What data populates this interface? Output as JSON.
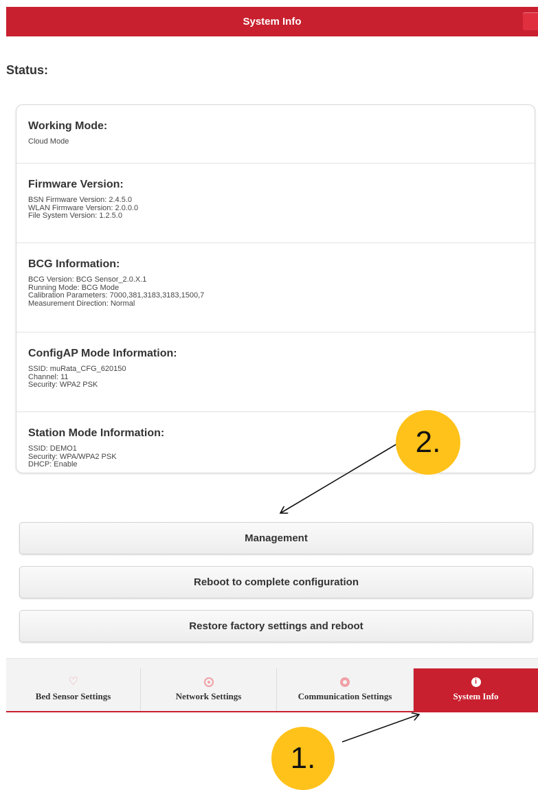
{
  "header": {
    "title": "System Info"
  },
  "status_heading": "Status:",
  "sections": [
    {
      "title": "Working Mode:",
      "lines": [
        "Cloud Mode"
      ]
    },
    {
      "title": "Firmware Version:",
      "lines": [
        "BSN Firmware Version: 2.4.5.0",
        "WLAN Firmware Version: 2.0.0.0",
        "File System Version: 1.2.5.0"
      ]
    },
    {
      "title": "BCG Information:",
      "lines": [
        "BCG Version: BCG Sensor_2.0.X.1",
        "Running Mode: BCG Mode",
        "Calibration Parameters: 7000,381,3183,3183,1500,7",
        "Measurement Direction: Normal"
      ]
    },
    {
      "title": "ConfigAP Mode Information:",
      "lines": [
        "SSID: muRata_CFG_620150",
        "Channel: 11",
        "Security: WPA2 PSK"
      ]
    },
    {
      "title": "Station Mode Information:",
      "lines": [
        "SSID: DEMO1",
        "Security: WPA/WPA2 PSK",
        "DHCP: Enable"
      ]
    }
  ],
  "buttons": {
    "management": "Management",
    "reboot": "Reboot to complete configuration",
    "restore": "Restore factory settings and reboot"
  },
  "tabs": [
    {
      "label": "Bed Sensor Settings",
      "icon": "heart-icon"
    },
    {
      "label": "Network Settings",
      "icon": "target-icon"
    },
    {
      "label": "Communication Settings",
      "icon": "gear-icon"
    },
    {
      "label": "System Info",
      "icon": "info-icon",
      "active": true
    }
  ],
  "annotations": {
    "one": "1.",
    "two": "2."
  },
  "colors": {
    "accent": "#c8202f",
    "callout": "#ffc21a"
  }
}
